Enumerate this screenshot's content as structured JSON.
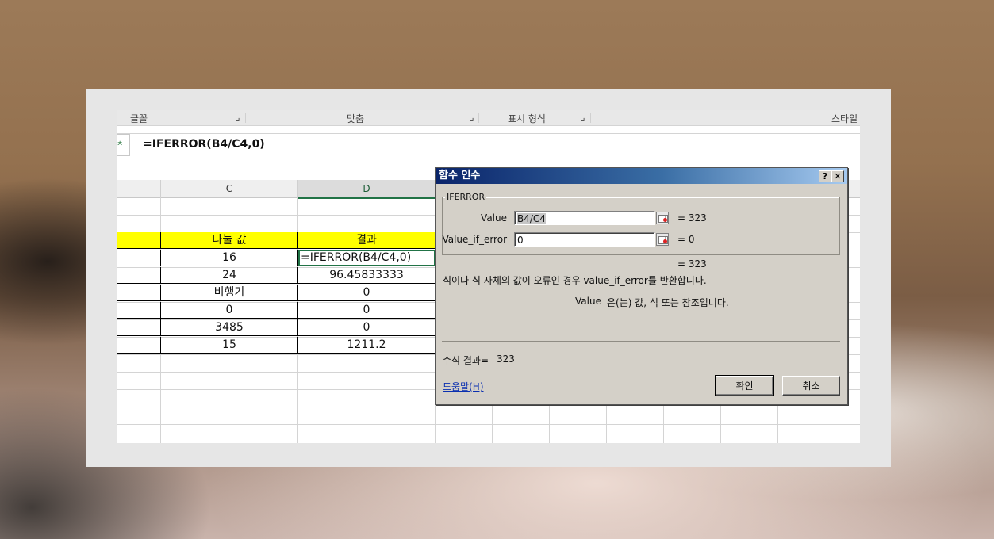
{
  "ribbon": {
    "groups": [
      "글꼴",
      "맞춤",
      "표시 형식",
      "스타일"
    ]
  },
  "formula_bar": {
    "fx_glyph": "ㅊ",
    "formula": "=IFERROR(B4/C4,0)"
  },
  "columns": [
    "C",
    "D"
  ],
  "table": {
    "header": [
      "나눌 값",
      "결과"
    ],
    "rows": [
      [
        "16",
        "=IFERROR(B4/C4,0)"
      ],
      [
        "24",
        "96.45833333"
      ],
      [
        "비행기",
        "0"
      ],
      [
        "0",
        "0"
      ],
      [
        "3485",
        "0"
      ],
      [
        "15",
        "1211.2"
      ]
    ]
  },
  "dialog": {
    "title": "함수 인수",
    "help_glyph": "?",
    "close_glyph": "✕",
    "function_name": "IFERROR",
    "args": [
      {
        "label": "Value",
        "value": "B4/C4",
        "result": "=  323"
      },
      {
        "label": "Value_if_error",
        "value": "0",
        "result": "=  0"
      }
    ],
    "overall_result": "=  323",
    "description": "식이나 식 자체의 값이 오류인 경우 value_if_error를 반환합니다.",
    "arg_help_name": "Value",
    "arg_help_text": "은(는) 값, 식 또는 참조입니다.",
    "formula_result_label": "수식 결과=",
    "formula_result_value": "323",
    "help_link": "도움말(H)",
    "ok_label": "확인",
    "cancel_label": "취소"
  }
}
